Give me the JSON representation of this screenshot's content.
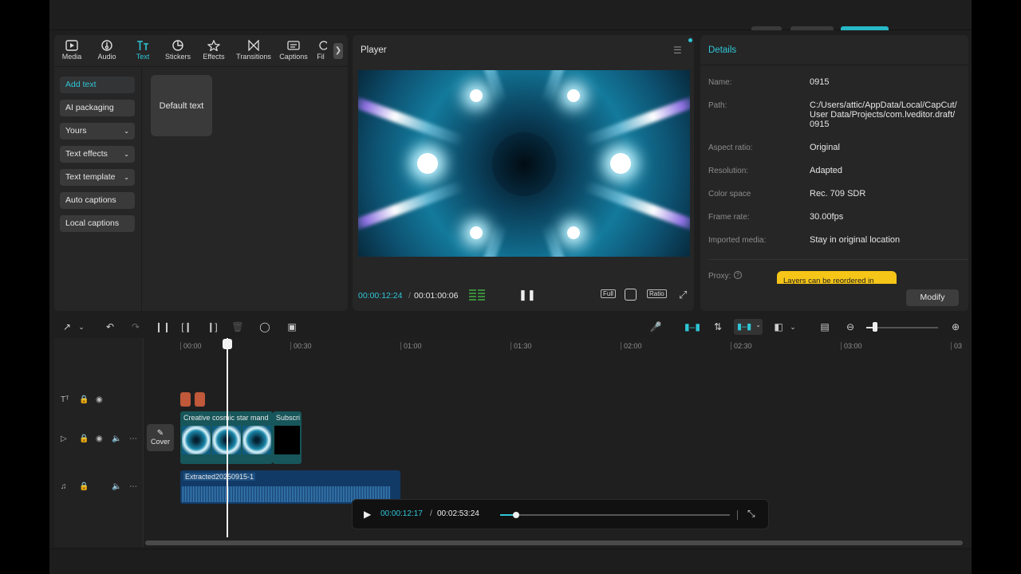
{
  "left_panel": {
    "tabs": [
      {
        "label": "Media",
        "icon": "media-icon"
      },
      {
        "label": "Audio",
        "icon": "audio-icon"
      },
      {
        "label": "Text",
        "icon": "text-icon",
        "active": true
      },
      {
        "label": "Stickers",
        "icon": "stickers-icon"
      },
      {
        "label": "Effects",
        "icon": "effects-icon"
      },
      {
        "label": "Transitions",
        "icon": "transitions-icon"
      },
      {
        "label": "Captions",
        "icon": "captions-icon"
      },
      {
        "label": "Fil",
        "icon": "filters-icon"
      }
    ],
    "side_items": [
      "Add text",
      "AI packaging",
      "Yours",
      "Text effects",
      "Text template",
      "Auto captions",
      "Local captions"
    ],
    "card_label": "Default text"
  },
  "player": {
    "title": "Player",
    "current_time": "00:00:12:24",
    "separator": "/",
    "total_time": "00:01:00:06",
    "full_label": "Full",
    "ratio_label": "Ratio"
  },
  "details": {
    "title": "Details",
    "rows": [
      {
        "label": "Name:",
        "value": "0915"
      },
      {
        "label": "Path:",
        "value": "C:/Users/attic/AppData/Local/CapCut/ User Data/Projects/com.lveditor.draft/ 0915"
      },
      {
        "label": "Aspect ratio:",
        "value": "Original"
      },
      {
        "label": "Resolution:",
        "value": "Adapted"
      },
      {
        "label": "Color space",
        "value": "Rec. 709 SDR"
      },
      {
        "label": "Frame rate:",
        "value": "30.00fps"
      },
      {
        "label": "Imported media:",
        "value": "Stay in original location"
      }
    ],
    "proxy_label": "Proxy:",
    "tooltip": "Layers can be reordered in",
    "modify_label": "Modify"
  },
  "timeline": {
    "ruler": [
      "00:00",
      "00:30",
      "01:00",
      "01:30",
      "02:00",
      "02:30",
      "03:00",
      "03"
    ],
    "video_clip_label": "Creative cosmic star mand",
    "video_clip2_label": "Subscri",
    "audio_clip_label": "Extracted20250915-1",
    "cover_label": "Cover"
  },
  "mini_player": {
    "current": "00:00:12:17",
    "separator": "/",
    "total": "00:02:53:24",
    "progress": 0.07
  },
  "colors": {
    "accent": "#2fc6d6",
    "tooltip": "#f5c518",
    "text_clip": "#c0583a",
    "video_clip": "#17565a",
    "audio_clip": "#123a66"
  }
}
